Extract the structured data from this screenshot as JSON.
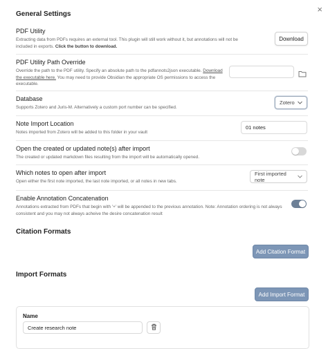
{
  "window": {
    "close_glyph": "×"
  },
  "general": {
    "title": "General Settings",
    "pdf_utility": {
      "name": "PDF Utility",
      "desc": "Extracting data from PDFs requires an external tool. This plugin will still work without it, but annotations will not be included in exports. ",
      "desc_bold": "Click the button to download.",
      "button": "Download"
    },
    "pdf_path": {
      "name": "PDF Utility Path Override",
      "desc_pre": "Override the path to the PDF utility. Specify an absolute path to the pdfannots2json executable. ",
      "link": "Download the executable here.",
      "desc_post": " You may need to provide Obsidian the appropriate OS permissions to access the executable.",
      "value": "",
      "folder_icon": "folder-icon"
    },
    "database": {
      "name": "Database",
      "desc": "Supports Zotero and Juris-M. Alternatively a custom port number can be specified.",
      "selected": "Zotero"
    },
    "import_location": {
      "name": "Note Import Location",
      "desc": "Notes imported from Zotero will be added to this folder in your vault",
      "value": "01 notes"
    },
    "open_notes": {
      "name": "Open the created or updated note(s) after import",
      "desc": "The created or updated markdown files resulting from the import will be automatically opened.",
      "enabled": false
    },
    "which_notes": {
      "name": "Which notes to open after import",
      "desc": "Open either the first note imported, the last note imported, or all notes in new tabs.",
      "selected": "First imported note"
    },
    "concat": {
      "name": "Enable Annotation Concatenation",
      "desc": "Annotations extracted from PDFs that begin with '+' will be appended to the previous annotation. Note: Annotation ordering is not always consistent and you may not always acheive the desire concatenation result",
      "enabled": true
    }
  },
  "citation": {
    "title": "Citation Formats",
    "button": "Add Citation Format"
  },
  "import": {
    "title": "Import Formats",
    "button": "Add Import Format",
    "card": {
      "name_label": "Name",
      "name_value": "Create research note",
      "delete_icon": "trash-icon"
    }
  },
  "colors": {
    "accent": "#7d96b6",
    "toggle_on": "#6d8097",
    "toggle_off": "#d8d8d8"
  }
}
